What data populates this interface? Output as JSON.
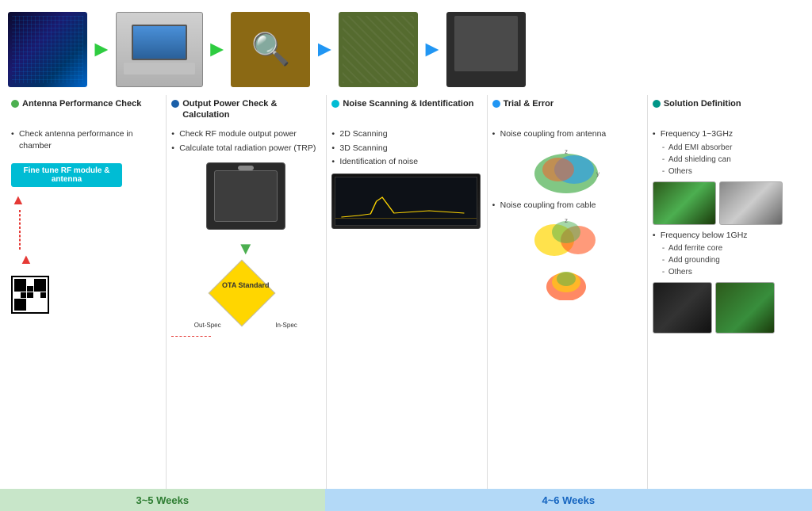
{
  "sections": [
    {
      "id": "antenna",
      "dotColor": "dot-green",
      "title": "Antenna Performance Check",
      "bullets": [
        "Check antenna performance in chamber"
      ],
      "sub_bullets": []
    },
    {
      "id": "output",
      "dotColor": "dot-blue-dark",
      "title": "Output Power Check & Calculation",
      "bullets": [
        "Check RF module output power",
        "Calculate total radiation power (TRP)"
      ]
    },
    {
      "id": "noise",
      "dotColor": "dot-cyan",
      "title": "Noise Scanning & Identification",
      "bullets": [
        "2D Scanning",
        "3D Scanning",
        "Identification of noise"
      ]
    },
    {
      "id": "trial",
      "dotColor": "dot-blue",
      "title": "Trial & Error",
      "bullets": [
        "Noise coupling from antenna",
        "Noise coupling from cable"
      ]
    },
    {
      "id": "solution",
      "dotColor": "dot-teal",
      "title": "Solution Definition",
      "freq1": "Frequency 1~3GHz",
      "freq1_items": [
        "Add EMI absorber",
        "Add shielding can",
        "Others"
      ],
      "freq2": "Frequency below 1GHz",
      "freq2_items": [
        "Add ferrite core",
        "Add  grounding",
        "Others"
      ]
    }
  ],
  "fine_tune": "Fine tune RF module & antenna",
  "ota_label": "OTA Standard",
  "out_spec": "Out-Spec",
  "in_spec": "In-Spec",
  "timeline": {
    "left": "3~5 Weeks",
    "right": "4~6 Weeks"
  }
}
